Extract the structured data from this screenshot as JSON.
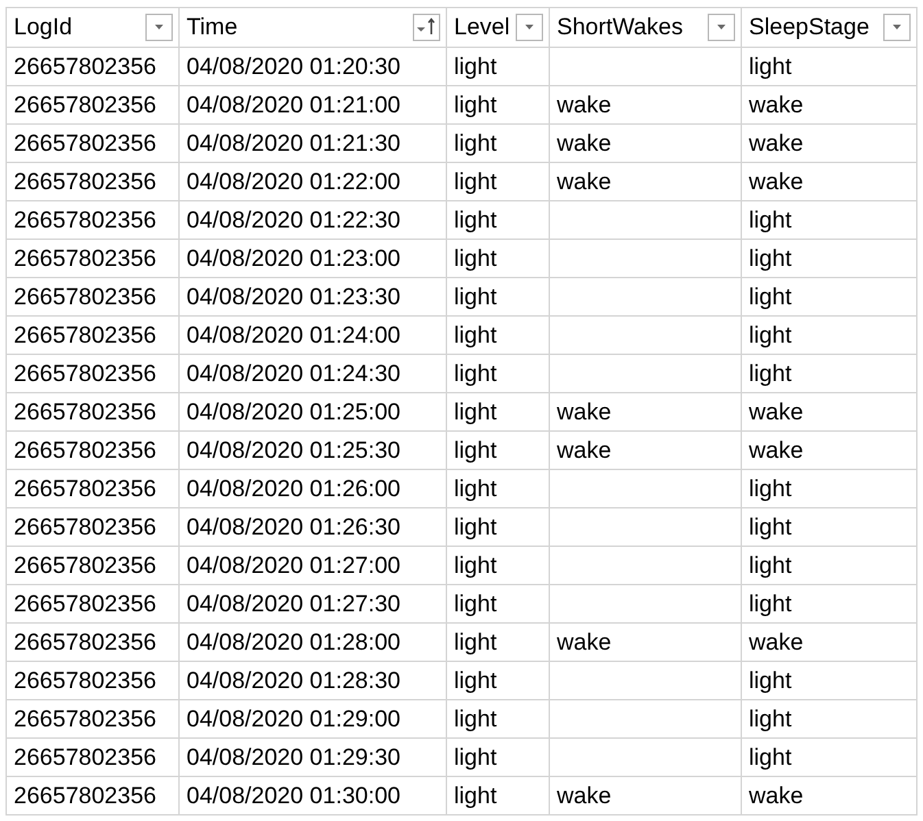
{
  "table": {
    "columns": [
      {
        "label": "LogId",
        "sorted": false
      },
      {
        "label": "Time",
        "sorted": true
      },
      {
        "label": "Level",
        "sorted": false
      },
      {
        "label": "ShortWakes",
        "sorted": false
      },
      {
        "label": "SleepStage",
        "sorted": false
      }
    ],
    "rows": [
      [
        "26657802356",
        "04/08/2020 01:20:30",
        "light",
        "",
        "light"
      ],
      [
        "26657802356",
        "04/08/2020 01:21:00",
        "light",
        "wake",
        "wake"
      ],
      [
        "26657802356",
        "04/08/2020 01:21:30",
        "light",
        "wake",
        "wake"
      ],
      [
        "26657802356",
        "04/08/2020 01:22:00",
        "light",
        "wake",
        "wake"
      ],
      [
        "26657802356",
        "04/08/2020 01:22:30",
        "light",
        "",
        "light"
      ],
      [
        "26657802356",
        "04/08/2020 01:23:00",
        "light",
        "",
        "light"
      ],
      [
        "26657802356",
        "04/08/2020 01:23:30",
        "light",
        "",
        "light"
      ],
      [
        "26657802356",
        "04/08/2020 01:24:00",
        "light",
        "",
        "light"
      ],
      [
        "26657802356",
        "04/08/2020 01:24:30",
        "light",
        "",
        "light"
      ],
      [
        "26657802356",
        "04/08/2020 01:25:00",
        "light",
        "wake",
        "wake"
      ],
      [
        "26657802356",
        "04/08/2020 01:25:30",
        "light",
        "wake",
        "wake"
      ],
      [
        "26657802356",
        "04/08/2020 01:26:00",
        "light",
        "",
        "light"
      ],
      [
        "26657802356",
        "04/08/2020 01:26:30",
        "light",
        "",
        "light"
      ],
      [
        "26657802356",
        "04/08/2020 01:27:00",
        "light",
        "",
        "light"
      ],
      [
        "26657802356",
        "04/08/2020 01:27:30",
        "light",
        "",
        "light"
      ],
      [
        "26657802356",
        "04/08/2020 01:28:00",
        "light",
        "wake",
        "wake"
      ],
      [
        "26657802356",
        "04/08/2020 01:28:30",
        "light",
        "",
        "light"
      ],
      [
        "26657802356",
        "04/08/2020 01:29:00",
        "light",
        "",
        "light"
      ],
      [
        "26657802356",
        "04/08/2020 01:29:30",
        "light",
        "",
        "light"
      ],
      [
        "26657802356",
        "04/08/2020 01:30:00",
        "light",
        "wake",
        "wake"
      ]
    ]
  }
}
